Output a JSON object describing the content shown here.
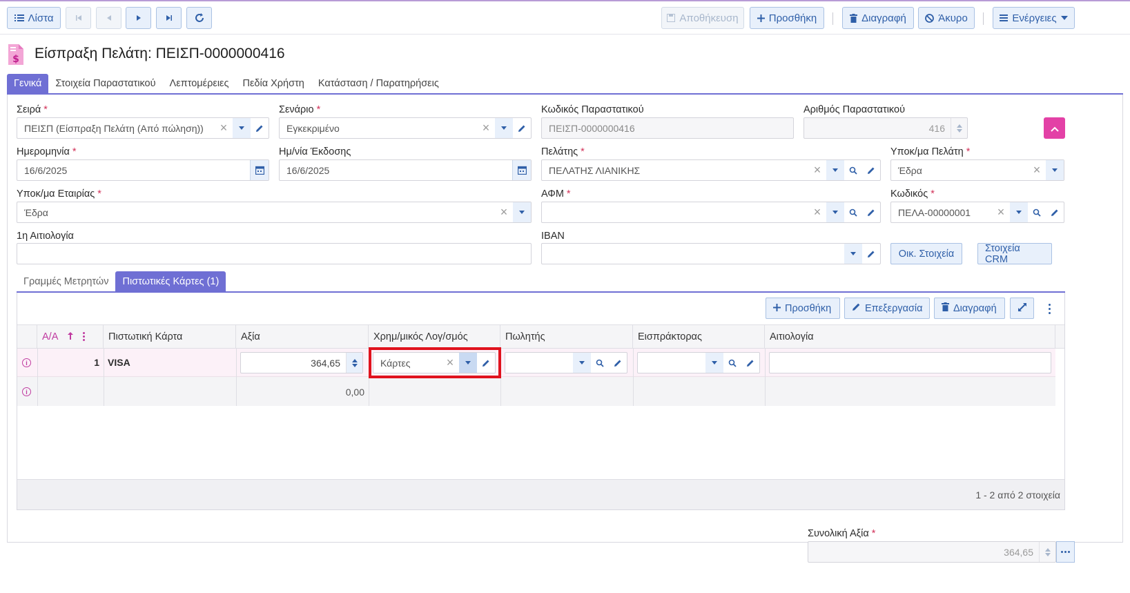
{
  "toolbar": {
    "list_label": "Λίστα",
    "save_label": "Αποθήκευση",
    "add_label": "Προσθήκη",
    "delete_label": "Διαγραφή",
    "cancel_label": "Άκυρο",
    "actions_label": "Ενέργειες"
  },
  "page": {
    "title": "Είσπραξη Πελάτη: ΠΕΙΣΠ-0000000416"
  },
  "tabs": [
    {
      "label": "Γενικά",
      "active": true
    },
    {
      "label": "Στοιχεία Παραστατικού"
    },
    {
      "label": "Λεπτομέρειες"
    },
    {
      "label": "Πεδία Χρήστη"
    },
    {
      "label": "Κατάσταση / Παρατηρήσεις"
    }
  ],
  "form": {
    "series": {
      "label": "Σειρά",
      "value": "ΠΕΙΣΠ (Είσπραξη Πελάτη (Από πώληση))"
    },
    "scenario": {
      "label": "Σενάριο",
      "value": "Εγκεκριμένο"
    },
    "doc_code": {
      "label": "Κωδικός Παραστατικού",
      "value": "ΠΕΙΣΠ-0000000416"
    },
    "doc_number": {
      "label": "Αριθμός Παραστατικού",
      "value": "416"
    },
    "date": {
      "label": "Ημερομηνία",
      "value": "16/6/2025"
    },
    "issue_date": {
      "label": "Ημ/νία Έκδοσης",
      "value": "16/6/2025"
    },
    "customer": {
      "label": "Πελάτης",
      "value": "ΠΕΛΑΤΗΣ ΛΙΑΝΙΚΗΣ"
    },
    "customer_branch": {
      "label": "Υποκ/μα Πελάτη",
      "value": "Έδρα"
    },
    "company_branch": {
      "label": "Υποκ/μα Εταιρίας",
      "value": "Έδρα"
    },
    "vat": {
      "label": "ΑΦΜ",
      "value": ""
    },
    "code": {
      "label": "Κωδικός",
      "value": "ΠΕΛΑ-00000001"
    },
    "reason": {
      "label": "1η Αιτιολογία",
      "value": ""
    },
    "iban": {
      "label": "IBAN",
      "value": ""
    },
    "financial_btn": "Οικ. Στοιχεία",
    "crm_btn": "Στοιχεία CRM"
  },
  "subtabs": [
    {
      "label": "Γραμμές Μετρητών"
    },
    {
      "label": "Πιστωτικές Κάρτες (1)",
      "active": true
    }
  ],
  "grid": {
    "add_label": "Προσθήκη",
    "edit_label": "Επεξεργασία",
    "delete_label": "Διαγραφή",
    "columns": {
      "aa": "Α/Α",
      "card": "Πιστωτική Κάρτα",
      "value": "Αξία",
      "account": "Χρημ/μικός Λογ/σμός",
      "seller": "Πωλητής",
      "collector": "Εισπράκτορας",
      "reason": "Αιτιολογία"
    },
    "rows": [
      {
        "aa": "1",
        "card": "VISA",
        "value": "364,65",
        "account": "Κάρτες"
      }
    ],
    "total_value": "0,00",
    "pager": "1 - 2 από 2 στοιχεία"
  },
  "total": {
    "label": "Συνολική Αξία",
    "value": "364,65"
  },
  "colors": {
    "accent": "#6f6fd4",
    "button_bg": "#e8f0fb",
    "button_text": "#2f5fa8",
    "required": "#d2335a",
    "highlight": "#e0131e",
    "pink": "#e341a6"
  }
}
